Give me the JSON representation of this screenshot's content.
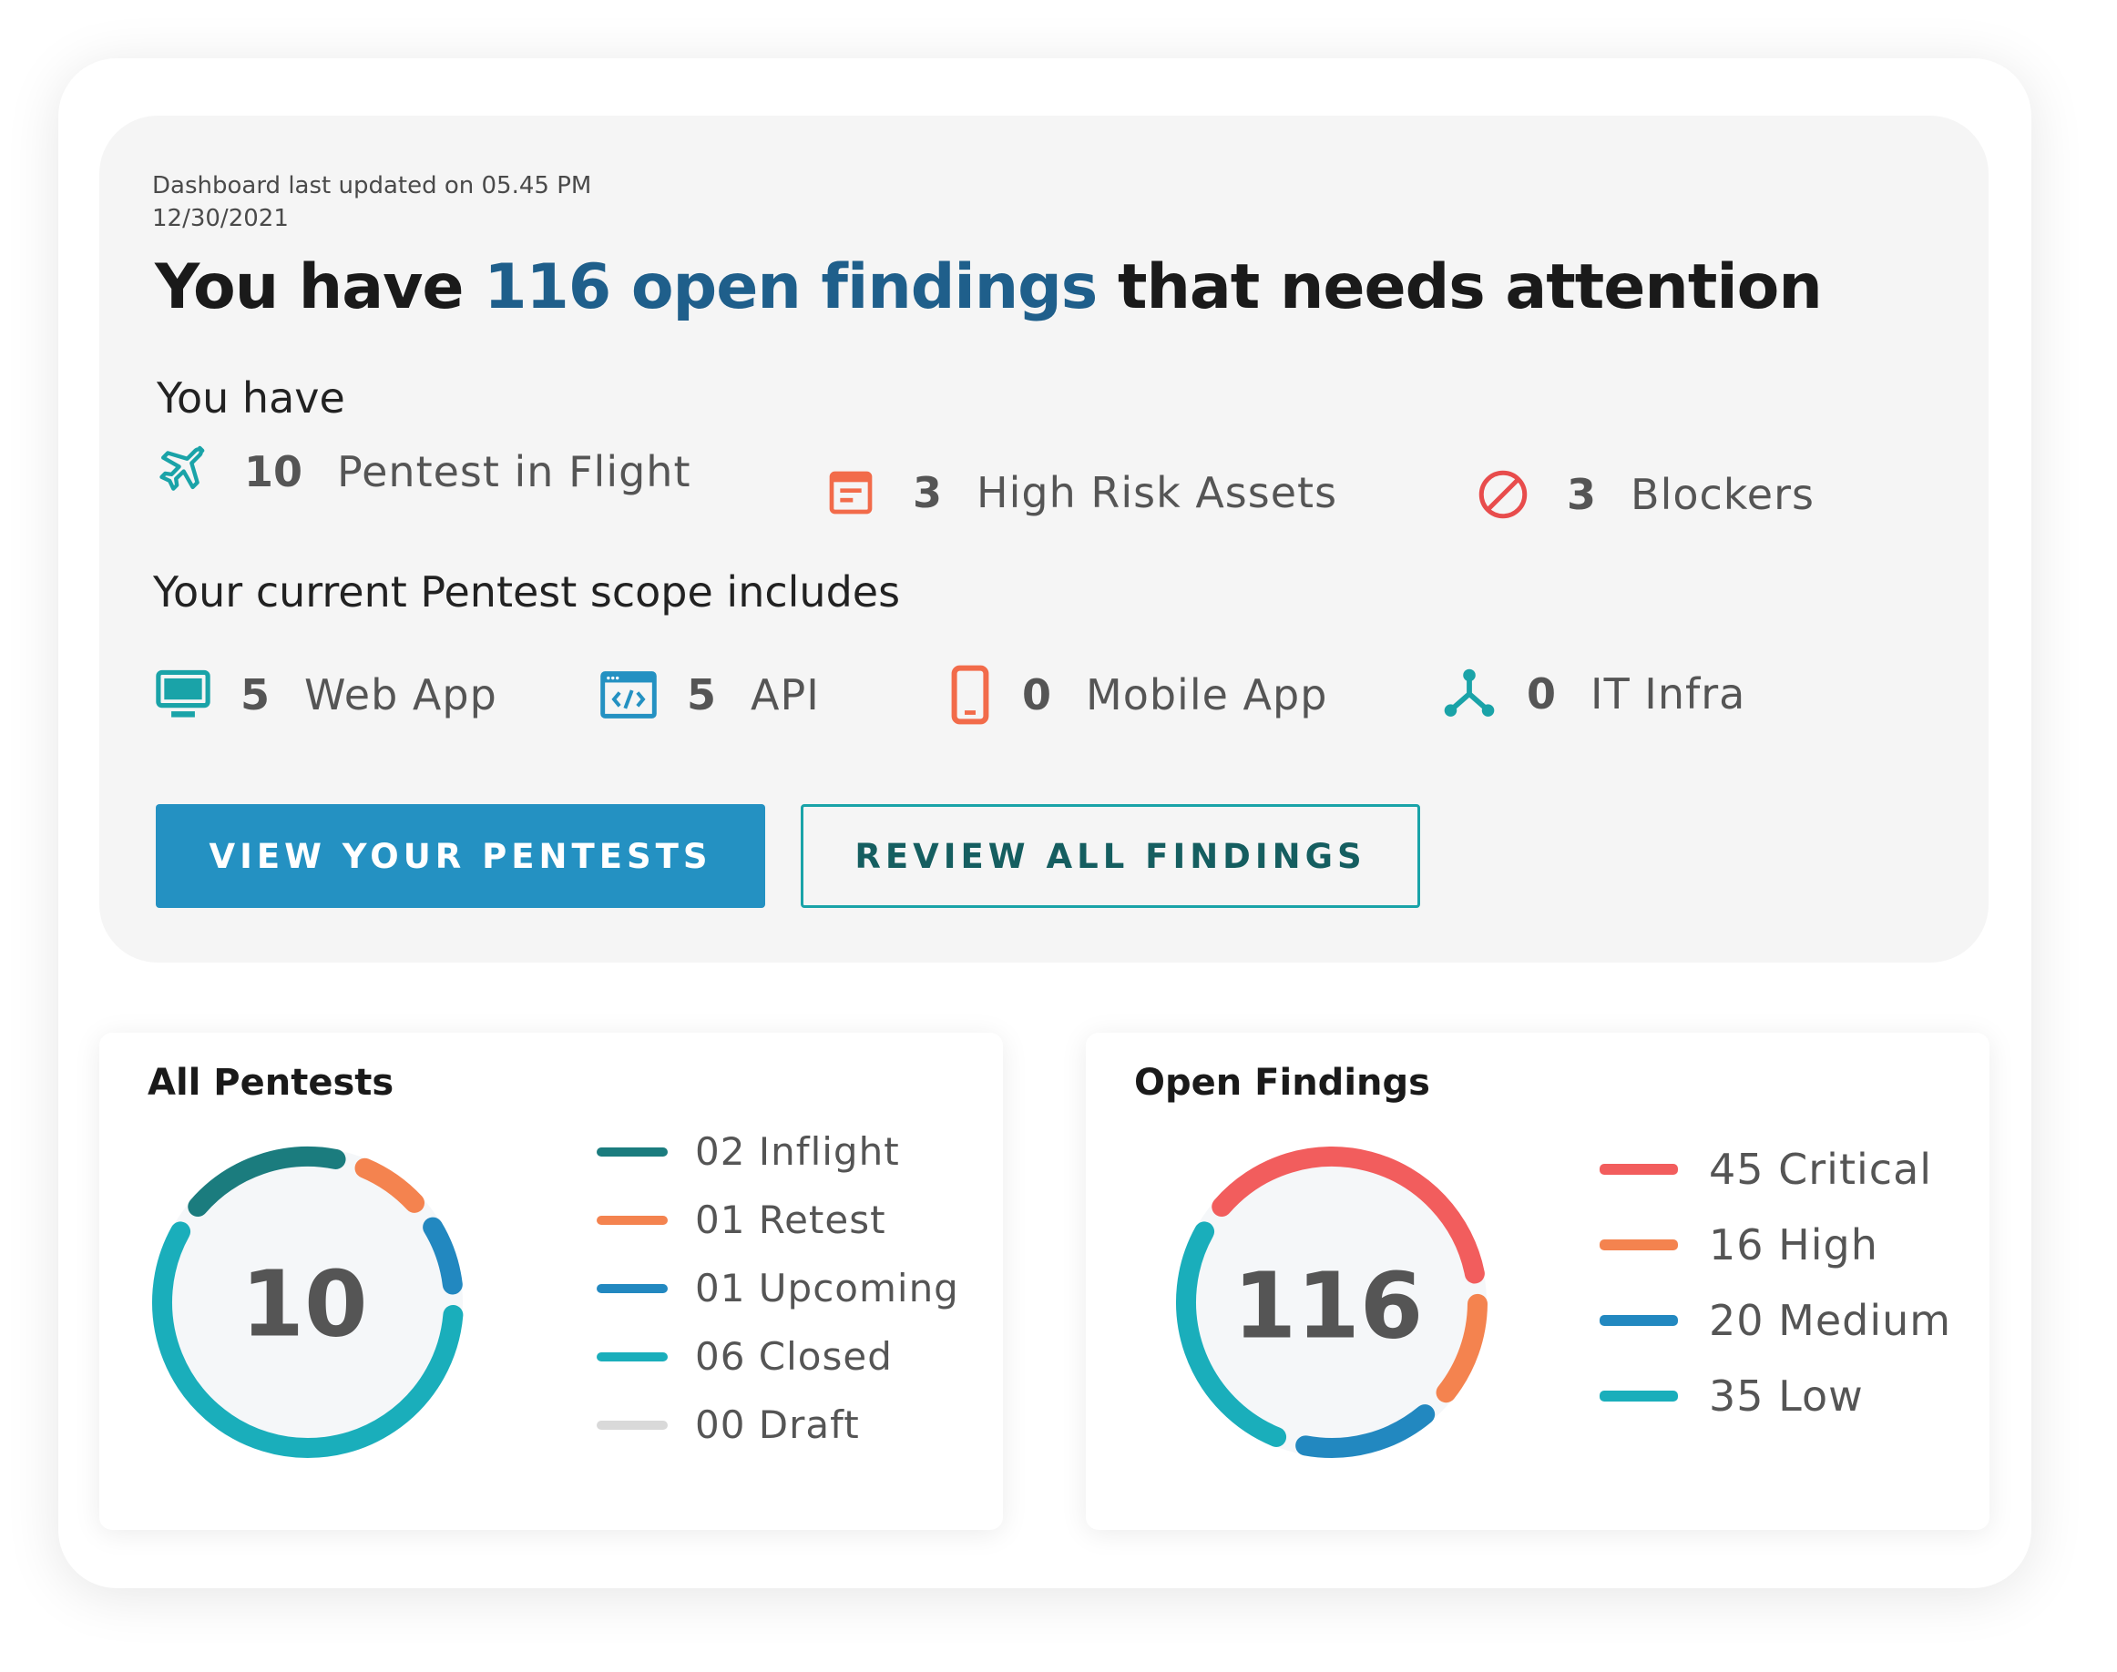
{
  "header": {
    "updated_line1": "Dashboard last updated on 05.45 PM",
    "updated_line2": "12/30/2021",
    "headline_prefix": "You have ",
    "headline_highlight": "116 open findings",
    "headline_suffix": " that needs attention"
  },
  "you_have": {
    "label": "You have",
    "stats": [
      {
        "value": "10",
        "label": "Pentest in Flight",
        "icon": "airplane-icon",
        "color": "#1aa3a8"
      },
      {
        "value": "3",
        "label": "High Risk Assets",
        "icon": "document-icon",
        "color": "#f26b4a"
      },
      {
        "value": "3",
        "label": "Blockers",
        "icon": "blocked-icon",
        "color": "#e84c4c"
      }
    ]
  },
  "scope": {
    "label": "Your current Pentest scope includes",
    "items": [
      {
        "value": "5",
        "label": "Web App",
        "icon": "monitor-icon",
        "color": "#1aa3a8"
      },
      {
        "value": "5",
        "label": "API",
        "icon": "code-window-icon",
        "color": "#2491c2"
      },
      {
        "value": "0",
        "label": "Mobile App",
        "icon": "mobile-icon",
        "color": "#f26b4a"
      },
      {
        "value": "0",
        "label": "IT Infra",
        "icon": "network-icon",
        "color": "#1aa3a8"
      }
    ]
  },
  "buttons": {
    "primary": "VIEW YOUR PENTESTS",
    "secondary": "REVIEW ALL FINDINGS"
  },
  "colors": {
    "primary": "#2491c2",
    "teal": "#1aa3a8",
    "dark_teal": "#1b7c7e",
    "orange": "#f4834f",
    "red": "#f25d5d",
    "blue": "#2288c0",
    "gray": "#d9d9d9",
    "highlight": "#1f5f8b"
  },
  "all_pentests": {
    "title": "All Pentests",
    "total": "10",
    "legend": [
      {
        "label": "02 Inflight",
        "value": 2,
        "color": "#1b7c7e"
      },
      {
        "label": "01 Retest",
        "value": 1,
        "color": "#f4834f"
      },
      {
        "label": "01 Upcoming",
        "value": 1,
        "color": "#2288c0"
      },
      {
        "label": "06 Closed",
        "value": 6,
        "color": "#1aaebb"
      },
      {
        "label": "00 Draft",
        "value": 0,
        "color": "#d9d9d9"
      }
    ]
  },
  "open_findings": {
    "title": "Open Findings",
    "total": "116",
    "legend": [
      {
        "label": "45 Critical",
        "value": 45,
        "color": "#f25d5d"
      },
      {
        "label": "16 High",
        "value": 16,
        "color": "#f4834f"
      },
      {
        "label": "20 Medium",
        "value": 20,
        "color": "#2288c0"
      },
      {
        "label": "35 Low",
        "value": 35,
        "color": "#1aaebb"
      }
    ]
  }
}
